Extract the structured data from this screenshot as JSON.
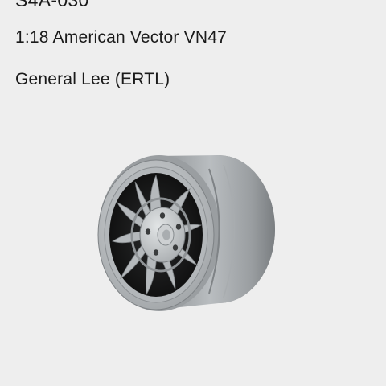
{
  "product": {
    "code": "S4A-030",
    "title": "1:18 American Vector VN47",
    "subtitle": "General Lee (ERTL)"
  },
  "image": {
    "subject": "wheel-rim-3d-render",
    "colors": {
      "background": "#eeeeee",
      "rim_light": "#c4c8ca",
      "rim_mid": "#9ca0a3",
      "rim_dark": "#6a6e71",
      "cavity": "#101010"
    }
  }
}
